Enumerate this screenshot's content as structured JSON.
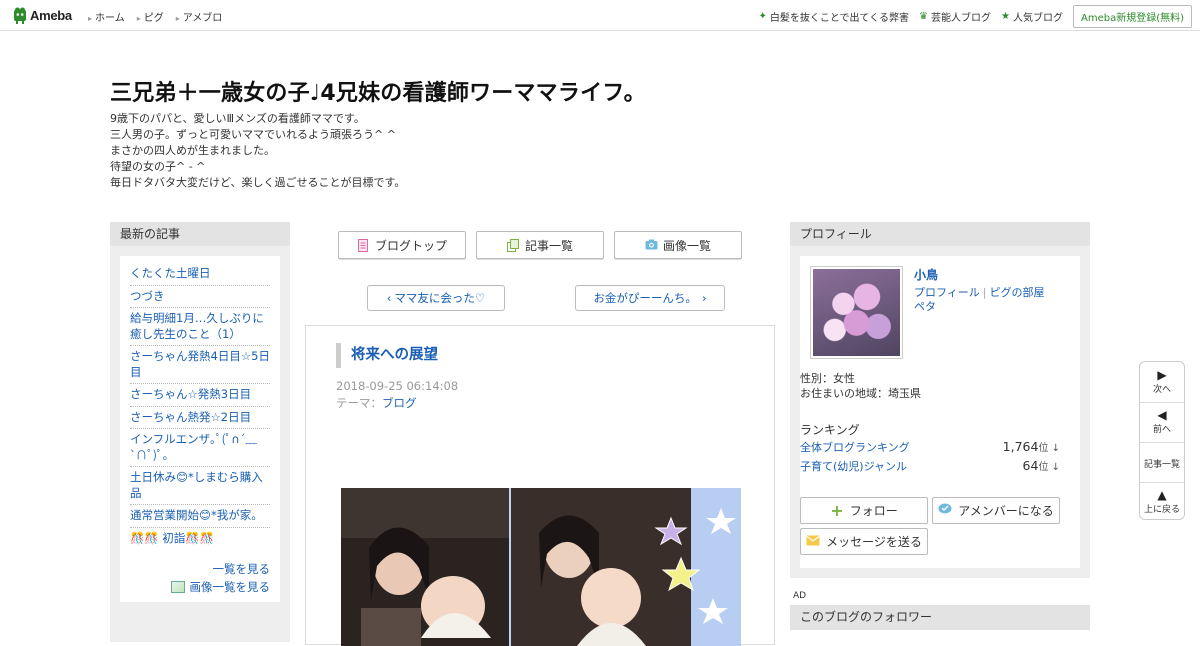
{
  "topbar": {
    "logo_text": "Ameba",
    "nav": [
      "ホーム",
      "ピグ",
      "アメブロ"
    ],
    "right_links": [
      {
        "label": "白髪を抜くことで出てくる弊害",
        "icon": "sparkle-icon"
      },
      {
        "label": "芸能人ブログ",
        "icon": "crown-icon"
      },
      {
        "label": "人気ブログ",
        "icon": "star-icon"
      }
    ],
    "register_label": "Ameba新規登録(無料)"
  },
  "header": {
    "title": "三兄弟＋一歳女の子♩4兄妹の看護師ワーママライフ。",
    "description": [
      "9歳下のパパと、愛しいⅢメンズの看護師ママです。",
      "三人男の子。ずっと可愛いママでいれるよう頑張ろう^ ^",
      "まさかの四人めが生まれました。",
      "待望の女の子^ - ^",
      "毎日ドタバタ大変だけど、楽しく過ごせることが目標です。"
    ]
  },
  "left": {
    "heading": "最新の記事",
    "recent": [
      "くたくた土曜日",
      "つづき",
      "給与明細1月…久しぶりに癒し先生のこと（1）",
      "さーちゃん発熱4日目☆5日目",
      "さーちゃん☆発熱3日目",
      "さーちゃん熱発☆2日目",
      "インフルエンザ｡ﾟ(ﾟ∩´﹏`∩ﾟ)ﾟ｡",
      "土日休み😊*しまむら購入品",
      "通常営業開始😊*我が家。",
      "🎊🎊 初詣🎊🎊"
    ],
    "see_all": "一覧を見る",
    "see_images": "画像一覧を見る"
  },
  "center": {
    "nav": [
      {
        "label": "ブログトップ",
        "icon": "document-icon"
      },
      {
        "label": "記事一覧",
        "icon": "pages-icon"
      },
      {
        "label": "画像一覧",
        "icon": "camera-icon"
      }
    ],
    "prev_entry": "ママ友に会った♡",
    "next_entry": "お金がぴーーんち。",
    "entry": {
      "title": "将来への展望",
      "date": "2018-09-25 06:14:08",
      "theme_label": "テーマ：",
      "theme": "ブログ"
    }
  },
  "profile": {
    "heading": "プロフィール",
    "name": "小鳥",
    "links": [
      "プロフィール",
      "ピグの部屋",
      "ペタ"
    ],
    "info": [
      "性別：女性",
      "お住まいの地域：埼玉県"
    ],
    "ranking_heading": "ランキング",
    "rankings": [
      {
        "label": "全体ブログランキング",
        "value": "1,764",
        "unit": "位 ↓"
      },
      {
        "label": "子育て(幼児)ジャンル",
        "value": "64",
        "unit": "位 ↓"
      }
    ],
    "follow_label": "フォロー",
    "amember_label": "アメンバーになる",
    "message_label": "メッセージを送る"
  },
  "ad_label": "AD",
  "followers_heading": "このブログのフォロワー",
  "float_nav": {
    "next": "次へ",
    "prev": "前へ",
    "list": "記事一覧",
    "top": "上に戻る"
  },
  "colors": {
    "link": "#1a5fb4",
    "ameba_green": "#2d8a2d",
    "sidebar_bg": "#eeeeee"
  }
}
